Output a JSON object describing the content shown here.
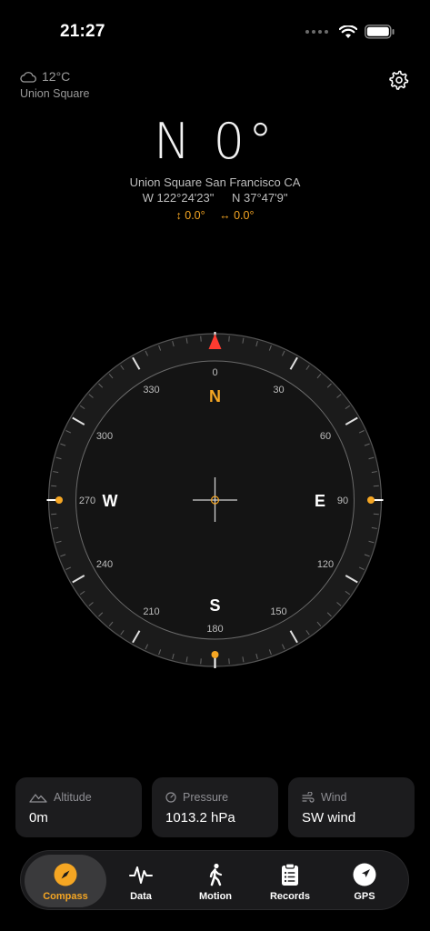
{
  "status_bar": {
    "time": "21:27"
  },
  "weather": {
    "temperature": "12°C",
    "location": "Union Square"
  },
  "heading": {
    "direction": "N",
    "degrees": "0°"
  },
  "location": {
    "place": "Union Square San Francisco CA",
    "longitude": "W 122°24'23\"",
    "latitude": "N 37°47'9\""
  },
  "tilt": {
    "vertical": "↕ 0.0°",
    "horizontal": "↔ 0.0°"
  },
  "compass": {
    "cardinals": {
      "north": "N",
      "east": "E",
      "south": "S",
      "west": "W"
    },
    "degree_labels": [
      "0",
      "30",
      "60",
      "90",
      "120",
      "150",
      "180",
      "210",
      "240",
      "270",
      "300",
      "330"
    ]
  },
  "cards": {
    "altitude": {
      "label": "Altitude",
      "value": "0m"
    },
    "pressure": {
      "label": "Pressure",
      "value": "1013.2 hPa"
    },
    "wind": {
      "label": "Wind",
      "value": "SW wind"
    }
  },
  "tabs": [
    {
      "label": "Compass",
      "icon": "compass-icon",
      "active": true
    },
    {
      "label": "Data",
      "icon": "pulse-icon",
      "active": false
    },
    {
      "label": "Motion",
      "icon": "walk-icon",
      "active": false
    },
    {
      "label": "Records",
      "icon": "clipboard-icon",
      "active": false
    },
    {
      "label": "GPS",
      "icon": "location-arrow-icon",
      "active": false
    }
  ],
  "colors": {
    "accent": "#f5a623",
    "north_marker": "#ff3b30",
    "background": "#000000",
    "card": "#1c1c1e"
  }
}
